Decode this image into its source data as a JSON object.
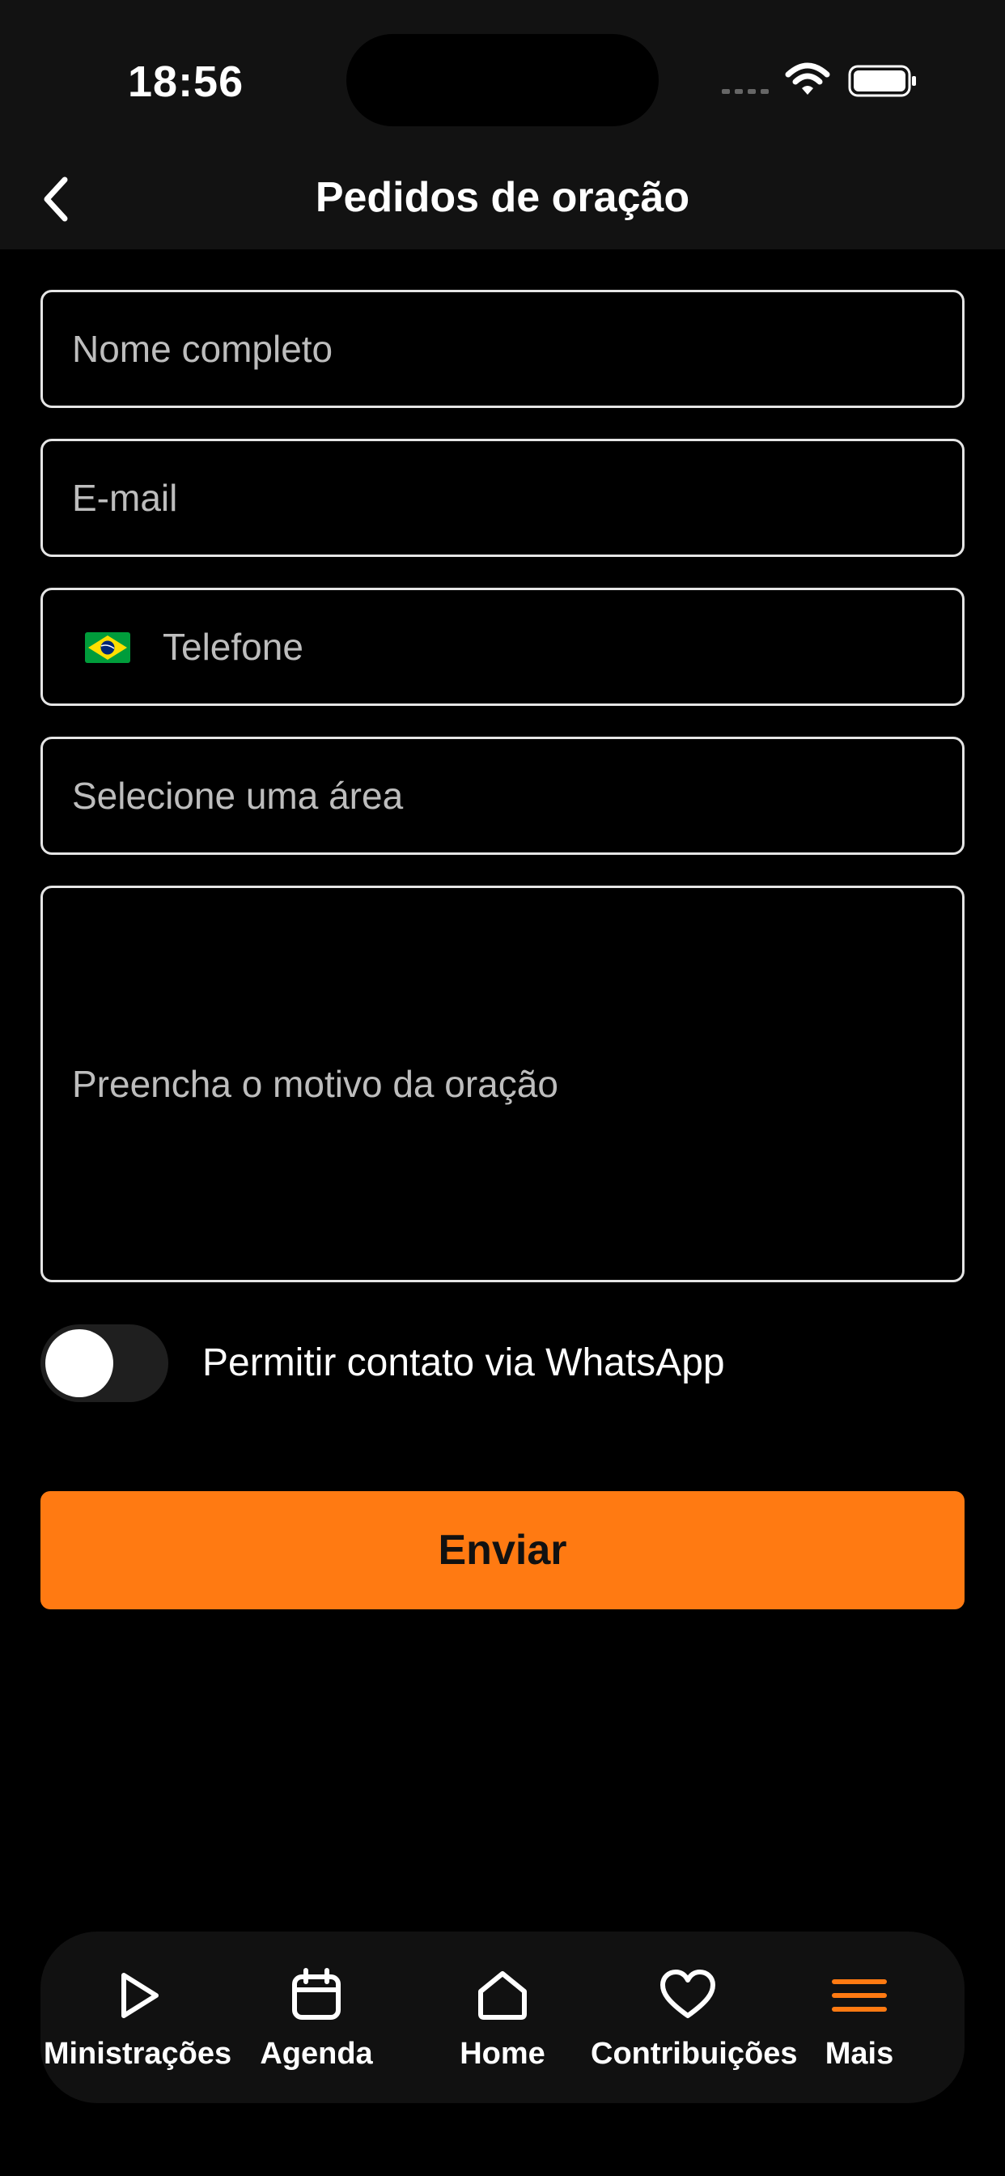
{
  "status_bar": {
    "time": "18:56"
  },
  "header": {
    "title": "Pedidos de oração",
    "back_icon": "chevron-left-icon"
  },
  "form": {
    "name_placeholder": "Nome completo",
    "email_placeholder": "E-mail",
    "phone_placeholder": "Telefone",
    "phone_flag_icon": "brazil-flag-icon",
    "area_placeholder": "Selecione uma área",
    "reason_placeholder": "Preencha o motivo da oração",
    "whatsapp_toggle_label": "Permitir contato via WhatsApp",
    "whatsapp_toggle_on": false,
    "submit_label": "Enviar"
  },
  "tab_bar": {
    "items": [
      {
        "label": "Ministrações",
        "icon": "play-icon",
        "active": false
      },
      {
        "label": "Agenda",
        "icon": "calendar-icon",
        "active": false
      },
      {
        "label": "Home",
        "icon": "home-icon",
        "active": false
      },
      {
        "label": "Contribuições",
        "icon": "heart-icon",
        "active": false
      },
      {
        "label": "Mais",
        "icon": "menu-icon",
        "active": true
      }
    ]
  },
  "colors": {
    "accent": "#ff7a12",
    "background": "#000000",
    "bar_background": "#121212",
    "placeholder": "#bdbdbd"
  }
}
